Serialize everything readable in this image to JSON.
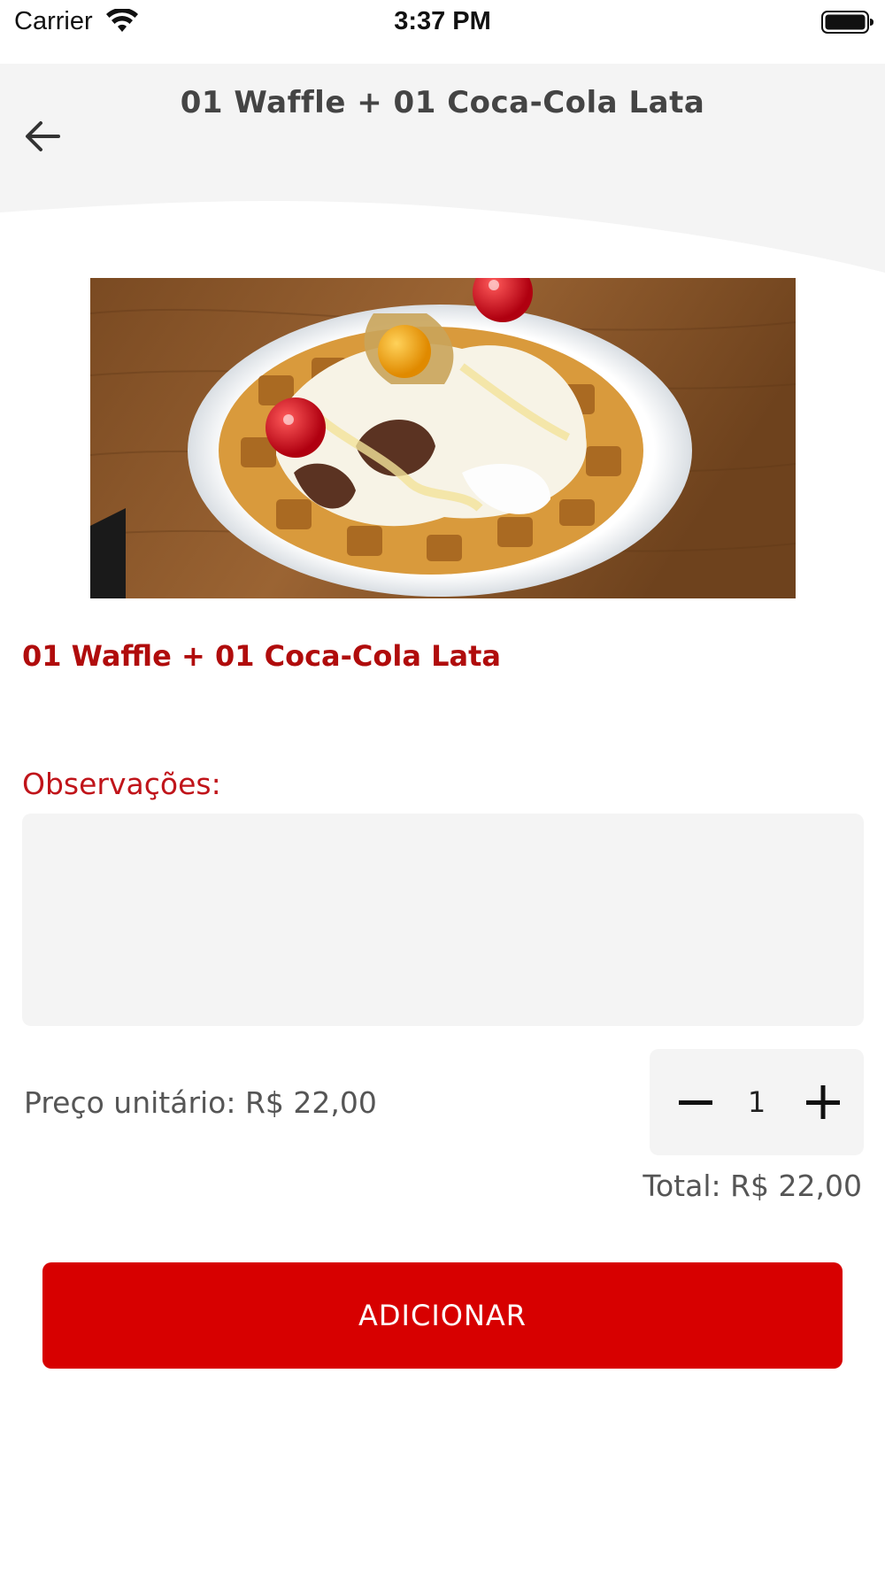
{
  "status_bar": {
    "carrier": "Carrier",
    "time": "3:37 PM",
    "wifi_icon": "wifi-icon",
    "battery_icon": "battery-full-icon"
  },
  "header": {
    "title": "01 Waffle + 01 Coca-Cola Lata",
    "back_icon": "arrow-left-icon"
  },
  "product": {
    "image_alt": "waffle-photo",
    "name": "01 Waffle + 01 Coca-Cola Lata"
  },
  "notes": {
    "label": "Observações:",
    "value": "",
    "placeholder": ""
  },
  "pricing": {
    "unit_price": "Preço unitário: R$ 22,00",
    "quantity": "1",
    "total": "Total: R$ 22,00"
  },
  "actions": {
    "add_label": "ADICIONAR"
  },
  "colors": {
    "accent": "#d70000",
    "product_name": "#b00c0c",
    "label_red": "#c0141a",
    "header_bg": "#f4f4f4",
    "input_bg": "#f4f4f4"
  }
}
